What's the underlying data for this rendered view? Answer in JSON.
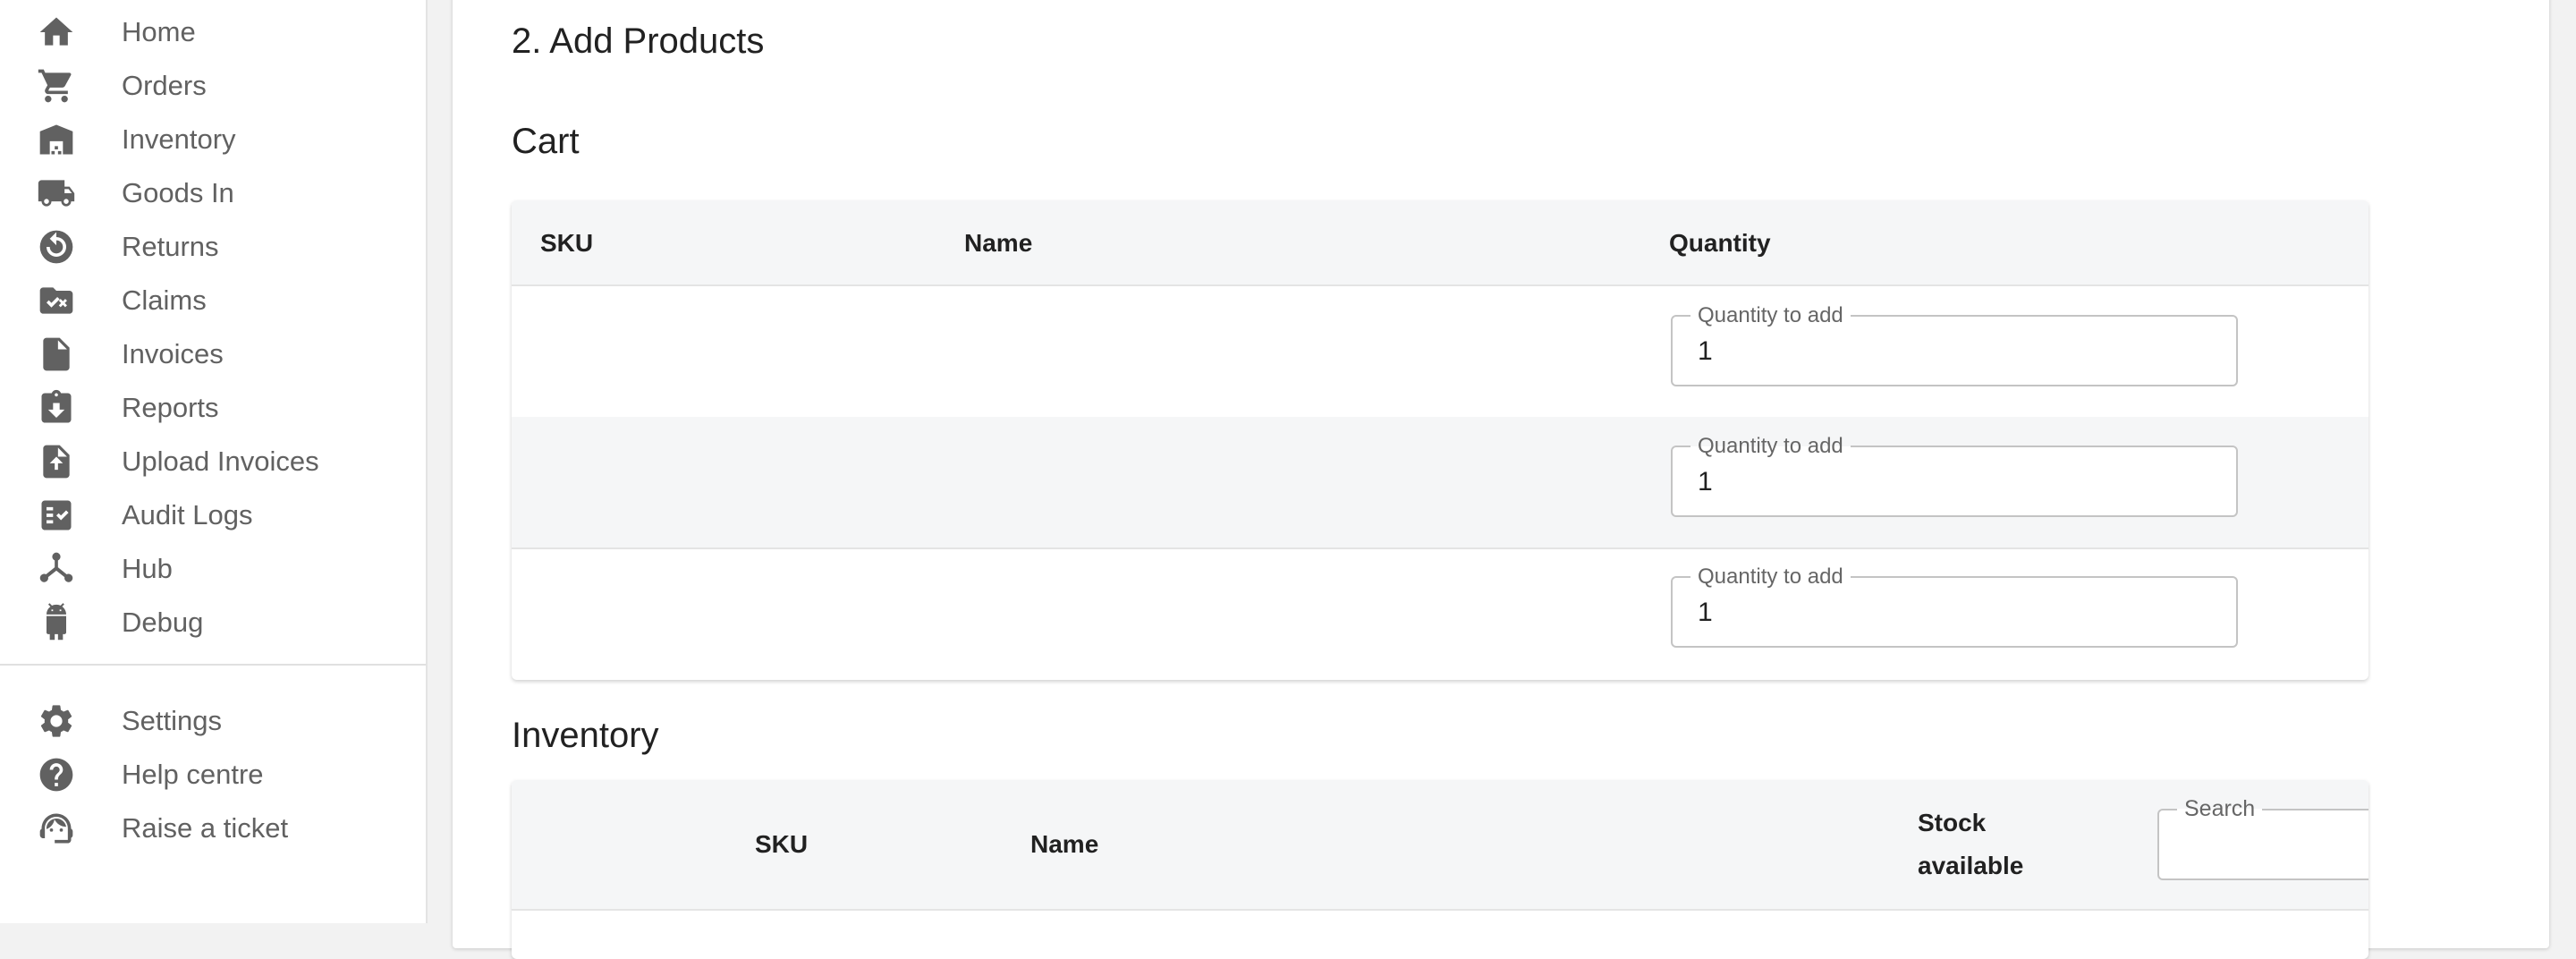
{
  "sidebar": {
    "items": [
      {
        "label": "Home",
        "icon": "home-icon"
      },
      {
        "label": "Orders",
        "icon": "cart-icon"
      },
      {
        "label": "Inventory",
        "icon": "warehouse-icon"
      },
      {
        "label": "Goods In",
        "icon": "truck-icon"
      },
      {
        "label": "Returns",
        "icon": "returns-icon"
      },
      {
        "label": "Claims",
        "icon": "folder-check-icon"
      },
      {
        "label": "Invoices",
        "icon": "document-icon"
      },
      {
        "label": "Reports",
        "icon": "report-download-icon"
      },
      {
        "label": "Upload Invoices",
        "icon": "file-upload-icon"
      },
      {
        "label": "Audit Logs",
        "icon": "checklist-icon"
      },
      {
        "label": "Hub",
        "icon": "hub-icon"
      },
      {
        "label": "Debug",
        "icon": "android-icon"
      }
    ],
    "bottom_items": [
      {
        "label": "Settings",
        "icon": "gear-icon"
      },
      {
        "label": "Help centre",
        "icon": "help-icon"
      },
      {
        "label": "Raise a ticket",
        "icon": "support-agent-icon"
      }
    ]
  },
  "main": {
    "step_title": "2. Add Products",
    "cart": {
      "title": "Cart",
      "columns": [
        "SKU",
        "Name",
        "Quantity"
      ],
      "rows": [
        {
          "sku": "",
          "name": "",
          "quantity_label": "Quantity to add",
          "quantity": "1"
        },
        {
          "sku": "",
          "name": "",
          "quantity_label": "Quantity to add",
          "quantity": "1"
        },
        {
          "sku": "",
          "name": "",
          "quantity_label": "Quantity to add",
          "quantity": "1"
        }
      ],
      "delete_icon": "delete-forever-icon"
    },
    "inventory": {
      "title": "Inventory",
      "columns": {
        "sku": "SKU",
        "name": "Name",
        "stock_line1": "Stock",
        "stock_line2": "available"
      },
      "search_label": "Search",
      "search_value": ""
    }
  },
  "colors": {
    "delete_button": "#933434",
    "highlight_border": "#e53222",
    "sidebar_icon": "#616161",
    "table_header_bg": "#f5f6f7"
  }
}
